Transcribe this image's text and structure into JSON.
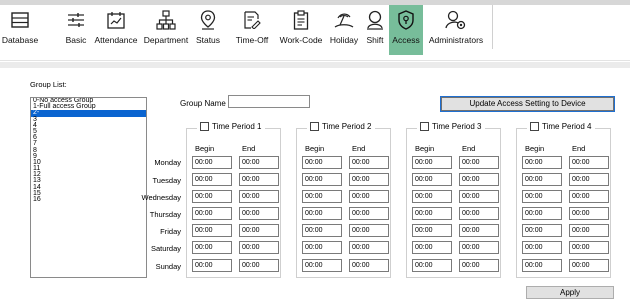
{
  "toolbar": {
    "items": [
      {
        "label": "Database",
        "icon": "database-icon"
      },
      {
        "label": "Basic",
        "icon": "sliders-icon"
      },
      {
        "label": "Attendance",
        "icon": "calendar-chart-icon"
      },
      {
        "label": "Department",
        "icon": "org-chart-icon"
      },
      {
        "label": "Status",
        "icon": "location-pin-icon"
      },
      {
        "label": "Time-Off",
        "icon": "document-edit-icon"
      },
      {
        "label": "Work-Code",
        "icon": "clipboard-icon"
      },
      {
        "label": "Holiday",
        "icon": "beach-icon"
      },
      {
        "label": "Shift",
        "icon": "person-icon"
      },
      {
        "label": "Access",
        "icon": "access-shield-icon",
        "active": true
      },
      {
        "label": "Administrators",
        "icon": "admin-gear-icon"
      }
    ],
    "active_color": "#77bd9a"
  },
  "group_list": {
    "label": "Group List:",
    "items": [
      "0-No access Group",
      "1-Full access Group",
      "2-",
      "3",
      "4",
      "5",
      "6",
      "7",
      "8",
      "9",
      "10",
      "11",
      "12",
      "13",
      "14",
      "15",
      "16"
    ],
    "selected_index": 2,
    "selection_color": "#0a64d0"
  },
  "group_name": {
    "label": "Group Name",
    "value": ""
  },
  "update_button": "Update Access Setting to Device",
  "days": [
    "Monday",
    "Tuesday",
    "Wednesday",
    "Thursday",
    "Friday",
    "Saturday",
    "Sunday"
  ],
  "periods": [
    {
      "title": "Time Period 1",
      "begin_label": "Begin",
      "end_label": "End",
      "begin": [
        "00:00",
        "00:00",
        "00:00",
        "00:00",
        "00:00",
        "00:00",
        "00:00"
      ],
      "end": [
        "00:00",
        "00:00",
        "00:00",
        "00:00",
        "00:00",
        "00:00",
        "00:00"
      ]
    },
    {
      "title": "Time Period 2",
      "begin_label": "Begin",
      "end_label": "End",
      "begin": [
        "00:00",
        "00:00",
        "00:00",
        "00:00",
        "00:00",
        "00:00",
        "00:00"
      ],
      "end": [
        "00:00",
        "00:00",
        "00:00",
        "00:00",
        "00:00",
        "00:00",
        "00:00"
      ]
    },
    {
      "title": "Time Period 3",
      "begin_label": "Begin",
      "end_label": "End",
      "begin": [
        "00:00",
        "00:00",
        "00:00",
        "00:00",
        "00:00",
        "00:00",
        "00:00"
      ],
      "end": [
        "00:00",
        "00:00",
        "00:00",
        "00:00",
        "00:00",
        "00:00",
        "00:00"
      ]
    },
    {
      "title": "Time Period 4",
      "begin_label": "Begin",
      "end_label": "End",
      "begin": [
        "00:00",
        "00:00",
        "00:00",
        "00:00",
        "00:00",
        "00:00",
        "00:00"
      ],
      "end": [
        "00:00",
        "00:00",
        "00:00",
        "00:00",
        "00:00",
        "00:00",
        "00:00"
      ]
    }
  ],
  "apply_button": "Apply"
}
